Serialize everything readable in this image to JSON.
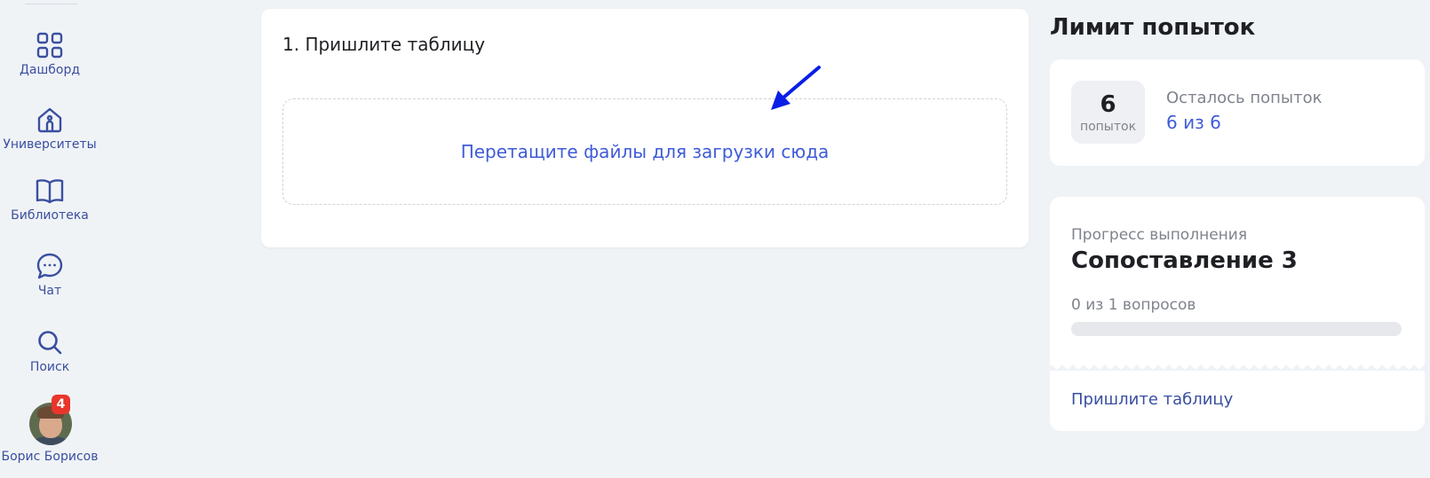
{
  "sidebar": {
    "items": [
      {
        "label": "Дашборд",
        "icon": "grid-icon"
      },
      {
        "label": "Университеты",
        "icon": "university-icon"
      },
      {
        "label": "Библиотека",
        "icon": "book-icon"
      },
      {
        "label": "Чат",
        "icon": "chat-icon"
      },
      {
        "label": "Поиск",
        "icon": "search-icon"
      }
    ],
    "user": {
      "name": "Борис Борисов",
      "notifications": "4"
    }
  },
  "task": {
    "title": "1. Пришлите таблицу",
    "dropzone_text": "Перетащите файлы для загрузки сюда"
  },
  "limit": {
    "heading": "Лимит попыток",
    "count": "6",
    "count_unit": "попыток",
    "remaining_label": "Осталось попыток",
    "remaining_value": "6 из 6"
  },
  "progress": {
    "caption": "Прогресс выполнения",
    "title": "Сопоставление 3",
    "count_text": "0 из 1 вопросов",
    "fraction": 0,
    "step_link": "Пришлите таблицу"
  },
  "colors": {
    "accent": "#3f5bd8",
    "nav": "#3a4fa0",
    "badge": "#e8362b",
    "background": "#f0f3f6",
    "annotation_arrow": "#0a1ee6"
  }
}
